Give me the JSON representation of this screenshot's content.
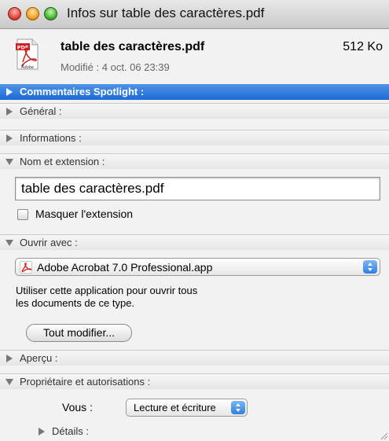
{
  "window": {
    "title": "Infos sur table des caractères.pdf"
  },
  "file": {
    "name": "table des caractères.pdf",
    "size": "512 Ko",
    "modified": "Modifié : 4 oct. 06 23:39",
    "icon": "pdf-file-icon"
  },
  "sections": {
    "spotlight": "Commentaires Spotlight :",
    "general": "Général :",
    "informations": "Informations :",
    "name_extension": "Nom et extension :",
    "open_with": "Ouvrir avec :",
    "preview": "Aperçu :",
    "ownership": "Propriétaire et autorisations :"
  },
  "name_extension": {
    "filename_value": "table des caractères.pdf",
    "hide_extension_label": "Masquer l'extension",
    "hide_extension_checked": false
  },
  "open_with": {
    "app_name": "Adobe Acrobat 7.0 Professional.app",
    "note_line1": "Utiliser cette application pour ouvrir tous",
    "note_line2": "les documents de ce type.",
    "change_all_button": "Tout modifier..."
  },
  "ownership": {
    "you_label": "Vous :",
    "you_permission": "Lecture et écriture",
    "details_label": "Détails :"
  },
  "colors": {
    "selected_bar": "#1d6ad6",
    "close": "#e0483c",
    "minimize": "#f2a426",
    "zoom": "#49b633"
  }
}
